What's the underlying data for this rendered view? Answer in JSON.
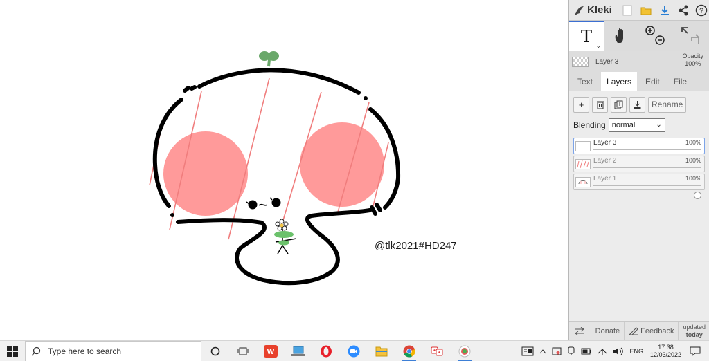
{
  "canvas": {
    "watermark": "@tlk2021#HD247"
  },
  "app": {
    "logo_text": "Kleki",
    "icons": [
      "new-image-icon",
      "open-folder-icon",
      "download-icon",
      "share-icon",
      "help-icon"
    ]
  },
  "toolbar": {
    "text_tool_glyph": "T",
    "caret": "⌄"
  },
  "layer_info": {
    "name": "Layer 3",
    "opacity_label": "Opacity",
    "opacity_value": "100%"
  },
  "tabs": [
    {
      "label": "Text"
    },
    {
      "label": "Layers"
    },
    {
      "label": "Edit"
    },
    {
      "label": "File"
    }
  ],
  "layer_buttons": {
    "add": "+",
    "rename": "Rename"
  },
  "blending": {
    "label": "Blending",
    "value": "normal"
  },
  "layers": [
    {
      "name": "Layer 3",
      "opacity": "100%",
      "level": 1.0
    },
    {
      "name": "Layer 2",
      "opacity": "100%",
      "level": 1.0
    },
    {
      "name": "Layer 1",
      "opacity": "100%",
      "level": 1.0
    }
  ],
  "bottom": {
    "donate": "Donate",
    "feedback": "Feedback",
    "updated_line1": "updated",
    "updated_line2": "today"
  },
  "taskbar": {
    "search_placeholder": "Type here to search",
    "lang": "ENG",
    "time": "17:38",
    "date": "12/03/2022"
  },
  "colors": {
    "accent": "#3b6fd2",
    "blush": "#ff9a9a",
    "sprout": "#6aa86a"
  }
}
